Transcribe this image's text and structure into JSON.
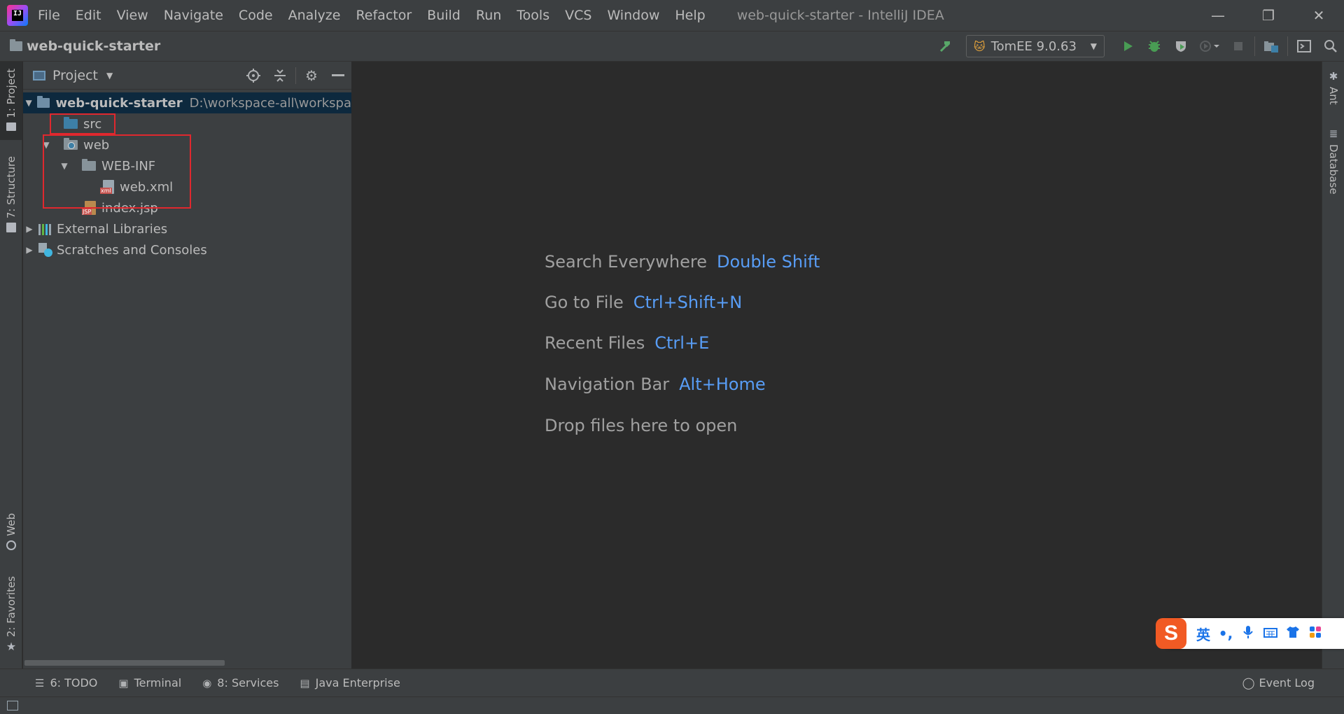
{
  "app": {
    "window_title": "web-quick-starter - IntelliJ IDEA",
    "logo_text": "IJ"
  },
  "menu": [
    "File",
    "Edit",
    "View",
    "Navigate",
    "Code",
    "Analyze",
    "Refactor",
    "Build",
    "Run",
    "Tools",
    "VCS",
    "Window",
    "Help"
  ],
  "window_controls": {
    "minimize": "—",
    "restore": "❐",
    "close": "✕"
  },
  "navbar": {
    "breadcrumb": "web-quick-starter",
    "run_config": "TomEE 9.0.63"
  },
  "left_strip": {
    "project_tab": "1: Project",
    "structure_tab": "7: Structure",
    "web_tab": "Web",
    "favorites_tab": "2: Favorites"
  },
  "right_strip": {
    "ant_tab": "Ant",
    "database_tab": "Database"
  },
  "project_panel": {
    "title": "Project",
    "tree": {
      "root_name": "web-quick-starter",
      "root_path": "D:\\workspace-all\\workspa",
      "src": "src",
      "web": "web",
      "web_inf": "WEB-INF",
      "web_xml": "web.xml",
      "index_jsp": "index.jsp",
      "external_libraries": "External Libraries",
      "scratches": "Scratches and Consoles"
    }
  },
  "editor": {
    "hints": [
      {
        "label": "Search Everywhere",
        "key": "Double Shift"
      },
      {
        "label": "Go to File",
        "key": "Ctrl+Shift+N"
      },
      {
        "label": "Recent Files",
        "key": "Ctrl+E"
      },
      {
        "label": "Navigation Bar",
        "key": "Alt+Home"
      },
      {
        "label": "Drop files here to open",
        "key": ""
      }
    ]
  },
  "bottom_bar": {
    "todo": "6: TODO",
    "terminal": "Terminal",
    "services": "8: Services",
    "java_enterprise": "Java Enterprise",
    "event_log": "Event Log"
  },
  "ime": {
    "logo": "S",
    "lang": "英",
    "punct": "•,"
  },
  "colors": {
    "accent_key": "#589df6",
    "highlight_box": "#e0282e",
    "run_green": "#499c54"
  }
}
